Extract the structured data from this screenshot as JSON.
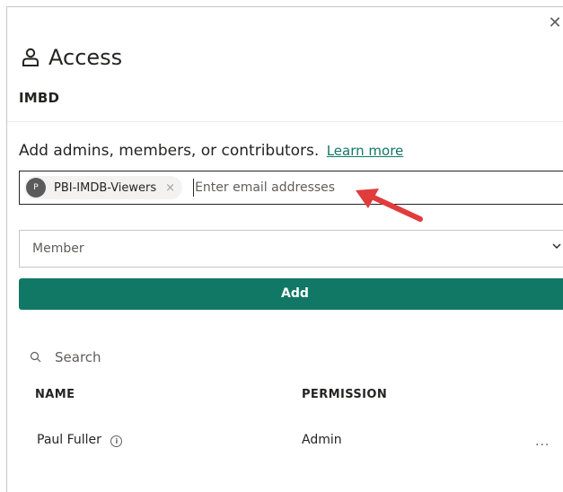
{
  "panel": {
    "title": "Access",
    "subtitle": "IMBD",
    "close_icon": "close-icon",
    "title_icon": "person-icon"
  },
  "instructions": {
    "text": "Add admins, members, or contributors.",
    "link": "Learn more"
  },
  "email_field": {
    "chips": [
      {
        "initial": "P",
        "label": "PBI-IMDB-Viewers",
        "remove": "×"
      }
    ],
    "placeholder": "Enter email addresses"
  },
  "role_select": {
    "value": "Member",
    "icon": "chevron-down-icon"
  },
  "add_button": {
    "label": "Add"
  },
  "search": {
    "label": "Search",
    "icon": "search-icon"
  },
  "table": {
    "columns": [
      "NAME",
      "PERMISSION"
    ],
    "rows": [
      {
        "name": "Paul Fuller",
        "info": "i",
        "permission": "Admin",
        "more": "..."
      }
    ]
  },
  "colors": {
    "accent": "#117865",
    "annotation_arrow": "#e03c3c"
  }
}
